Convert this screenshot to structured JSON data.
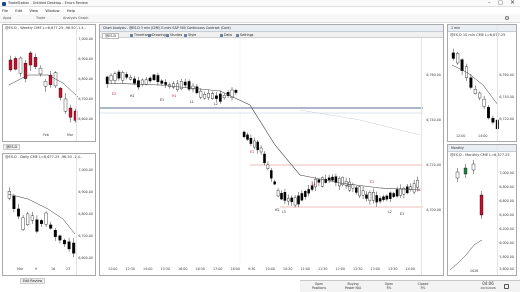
{
  "app": {
    "title": "TradeStation - Untitled Desktop - Errors Review",
    "window_buttons": {
      "minimize": "–",
      "maximize": "□",
      "close": "×"
    }
  },
  "menu": [
    "File",
    "Edit",
    "View",
    "Window",
    "Help"
  ],
  "ribbon": {
    "items": [
      "Apps",
      "Trade",
      "Analysis Graph"
    ]
  },
  "windows": {
    "tl": {
      "label": "@ES.D - Weekly  CME  L=6,677.25  -96.50  -1.4..",
      "y_ticks": [
        "7,000.00",
        "6,900.00",
        "6,800.00",
        "6,700.00",
        "6,600.00"
      ],
      "x_ticks": [
        "Feb",
        "Mar"
      ],
      "tab": "@ES.D"
    },
    "bl": {
      "label": "@ES.D - Daily  CME  L=6,677.25  -96.50  -1.4..",
      "y_ticks": [
        "7,000.00",
        "6,900.00",
        "6,800.00",
        "6,700.00",
        "6,600.00"
      ],
      "x_ticks": [
        "Mar",
        "9",
        "16",
        "23"
      ],
      "tab": "Edit Review"
    },
    "main": {
      "title": "Chart Analysis - @ES.D 3 min (CME) E-mini S&P 500 Continuous Contract (Cont)",
      "toolbar": [
        "@ES.D",
        "Timeframe",
        "Drawing",
        "Studies",
        "Style",
        "Data",
        "Settings"
      ],
      "y_ticks": [
        "6,760.00",
        "6,740.00",
        "6,720.00",
        "6,700.00"
      ],
      "x_ticks": [
        "12:00",
        "12:30",
        "14:00",
        "15:30",
        "16:00",
        "16:30",
        "17:00",
        "18:00",
        "9:30",
        "10:00",
        "10:30",
        "11:00",
        "11:30",
        "12:00",
        "12:30",
        "13:00",
        "13:30",
        "14:00"
      ],
      "bar_labels": [
        "E2",
        "H2",
        "E1",
        "H1",
        "L1",
        "L2",
        "E1",
        "H2",
        "L3",
        "L1",
        "E2",
        "H2",
        "E1",
        "L2",
        "E1",
        "H2"
      ]
    },
    "tr": {
      "title": "1 min",
      "label": "@ES.D 10 min  CME  L=6,677.25",
      "y_ticks": [
        "6,760.00",
        "6,740.00",
        "6,720.00"
      ],
      "x_ticks": [
        "12:00",
        "14:00"
      ]
    },
    "br": {
      "title": "Monthly",
      "label": "@ES.D - Monthly  CME  L=6,677.25",
      "y_ticks": [
        "7,000.00",
        "6,800.00",
        "6,600.00",
        "6,400.00",
        "6,200.00",
        "6,000.00",
        "5,800.00",
        "5,600.00"
      ],
      "x_ticks": [
        "2026"
      ]
    }
  },
  "statusbar": {
    "cells": [
      {
        "label": "Open",
        "value": "Positions"
      },
      {
        "label": "Buying",
        "value": "Power N/A"
      },
      {
        "label": "Open",
        "value": "P/L"
      },
      {
        "label": "Closed",
        "value": "P/L"
      }
    ],
    "time": "04:06",
    "date": "10/3/2026"
  },
  "colors": {
    "bull": "#ffffff",
    "bear": "#000000",
    "ema": "#444444",
    "marker_red": "#c8102e",
    "marker_green": "#1a8a3a",
    "level_line": "#1f3f6e"
  }
}
